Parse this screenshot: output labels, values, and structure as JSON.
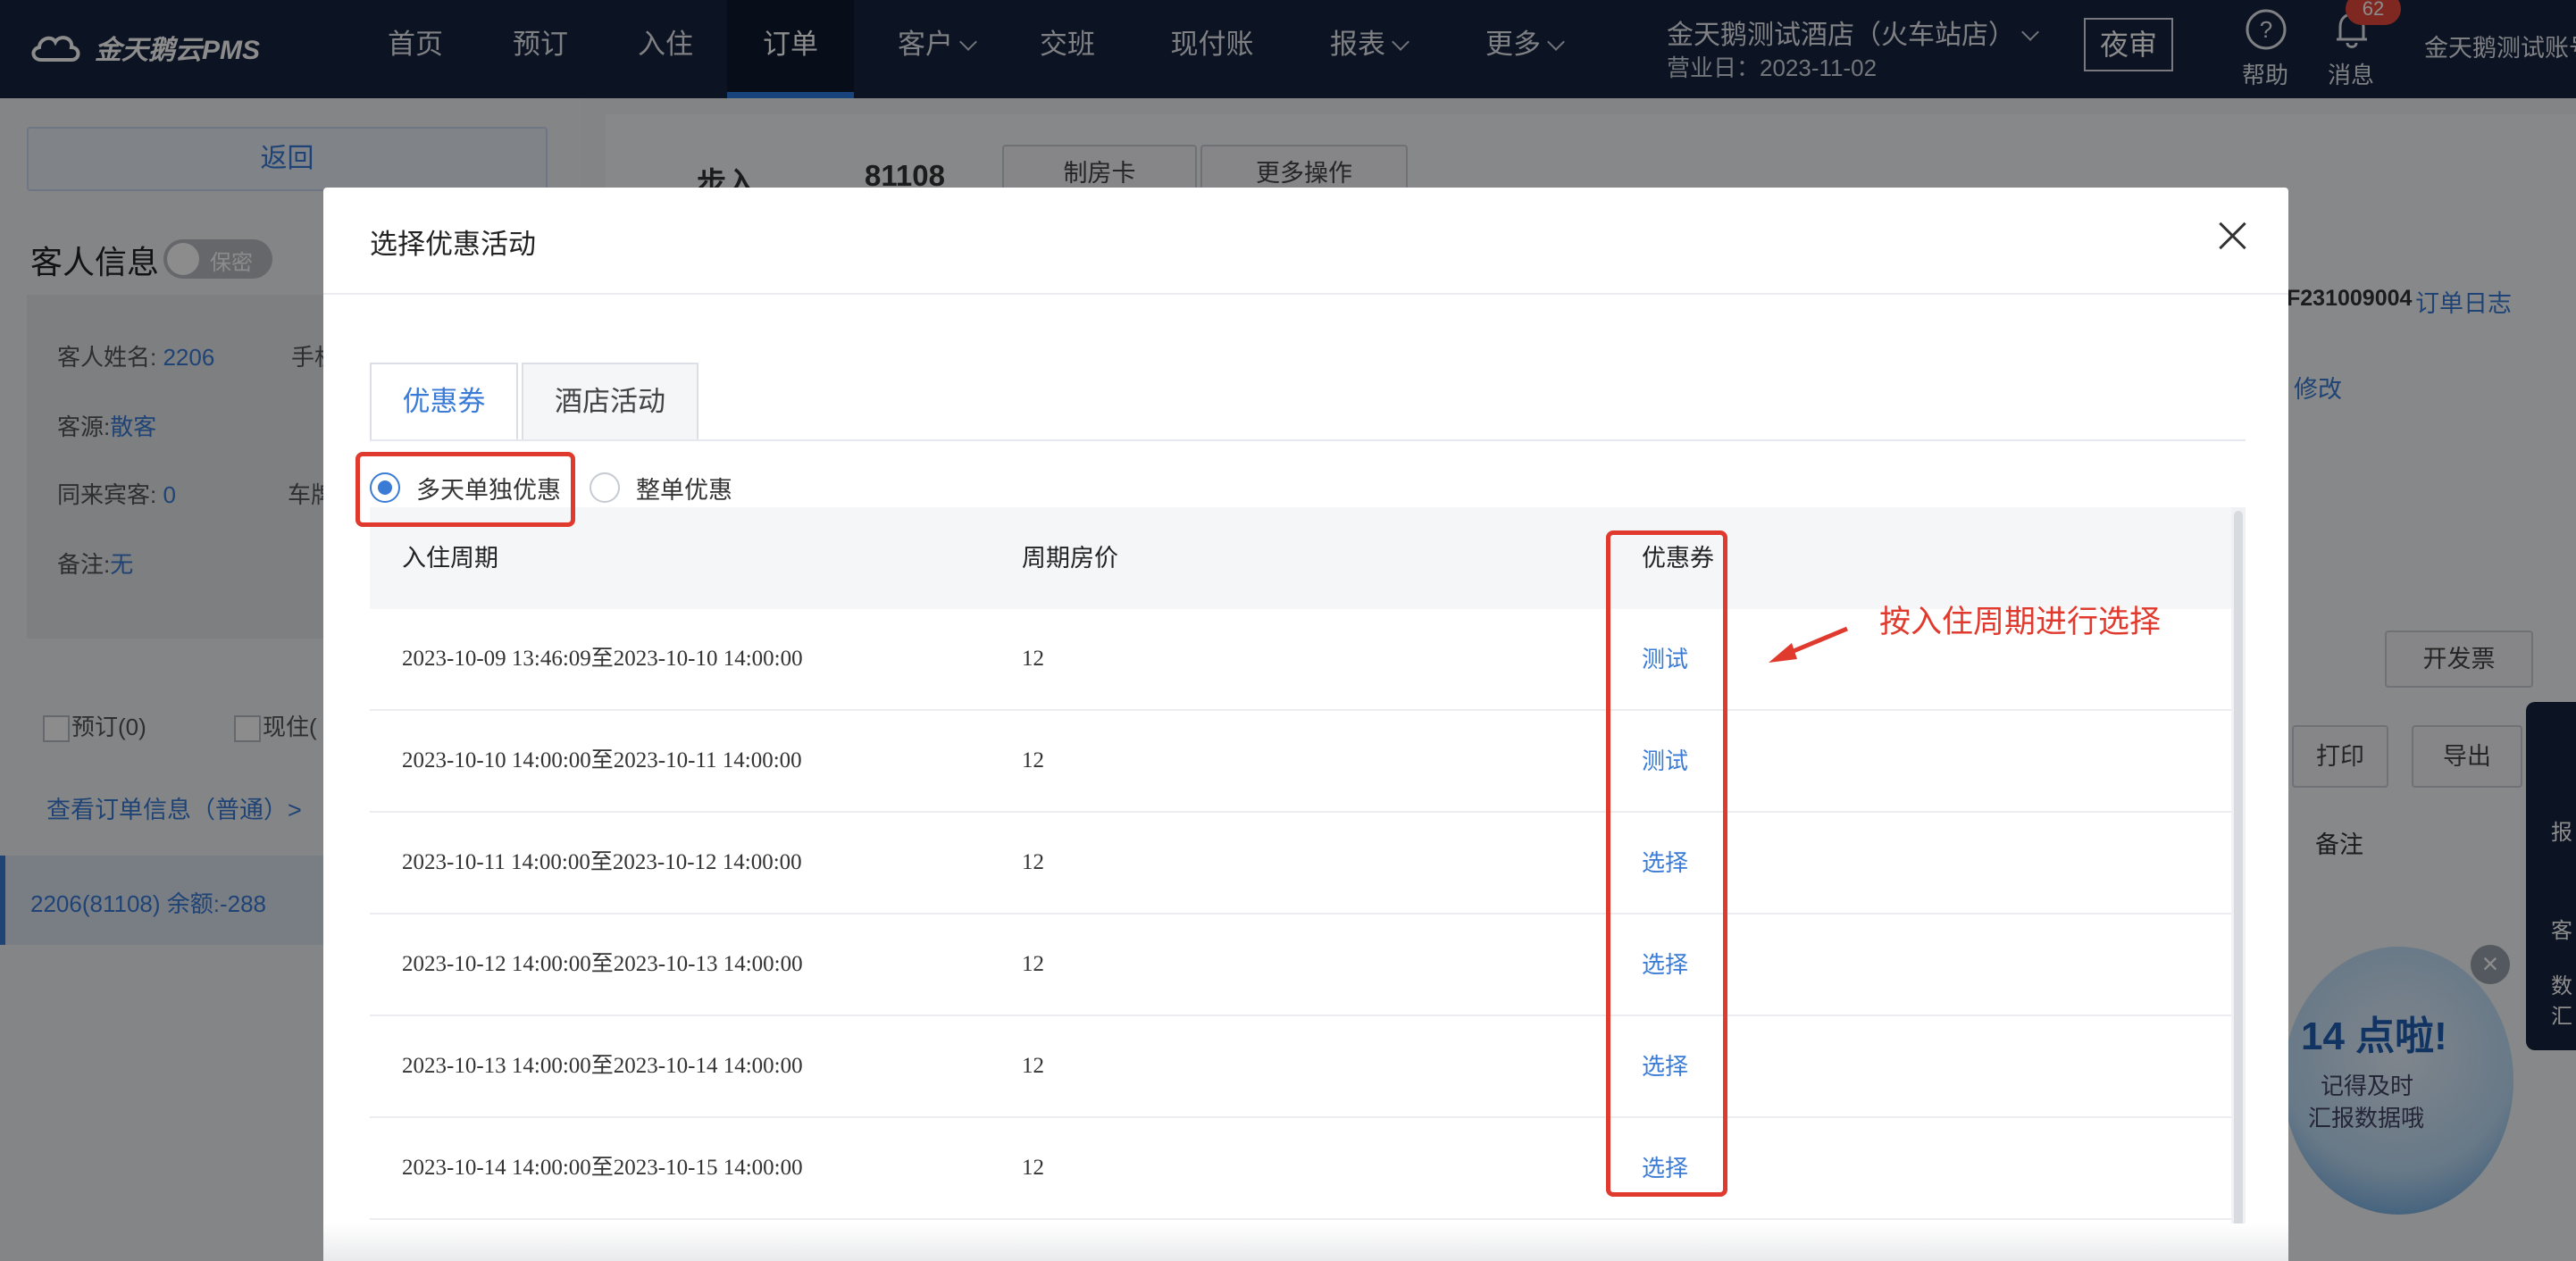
{
  "nav": {
    "logo": "金天鹅云PMS",
    "items": [
      "首页",
      "预订",
      "入住",
      "订单",
      "客户",
      "交班",
      "现付账",
      "报表",
      "更多"
    ],
    "hotel": "金天鹅测试酒店（火车站店）",
    "business_day": "营业日：2023-11-02",
    "night_audit": "夜审",
    "help": "帮助",
    "messages": "消息",
    "message_count": "62",
    "account": "金天鹅测试账号"
  },
  "background": {
    "back": "返回",
    "guest_info": "客人信息",
    "privacy": "保密",
    "guest_name_label": "客人姓名:",
    "guest_name": "2206",
    "phone_label": "手机",
    "source_label": "客源:",
    "source": "散客",
    "companions_label": "同来宾客:",
    "companions": "0",
    "car_label": "车牌",
    "remark_label": "备注:",
    "remark": "无",
    "reserved": "预订(0)",
    "checked_in": "现住(",
    "view_order": "查看订单信息（普通）>",
    "room_row": "2206(81108)   余额:-288",
    "walk_in": "步入",
    "order_no": "81108",
    "make_card": "制房卡",
    "more_ops": "更多操作",
    "order_code": "F231009004",
    "order_log": "订单日志",
    "modify": "修改",
    "invoice": "开发票",
    "print": "打印",
    "export": "导出",
    "remark_col": "备注",
    "reminder_title": "14 点啦!",
    "reminder_line1": "记得及时",
    "reminder_line2": "汇报数据哦",
    "side_report": "报",
    "side_customer": "客",
    "side_data1": "数",
    "side_data2": "汇"
  },
  "modal": {
    "title": "选择优惠活动",
    "tabs": [
      "优惠券",
      "酒店活动"
    ],
    "radios": [
      "多天单独优惠",
      "整单优惠"
    ],
    "columns": [
      "入住周期",
      "周期房价",
      "优惠券"
    ],
    "rows": [
      {
        "period": "2023-10-09 13:46:09至2023-10-10 14:00:00",
        "price": "12",
        "coupon": "测试"
      },
      {
        "period": "2023-10-10 14:00:00至2023-10-11 14:00:00",
        "price": "12",
        "coupon": "测试"
      },
      {
        "period": "2023-10-11 14:00:00至2023-10-12 14:00:00",
        "price": "12",
        "coupon": "选择"
      },
      {
        "period": "2023-10-12 14:00:00至2023-10-13 14:00:00",
        "price": "12",
        "coupon": "选择"
      },
      {
        "period": "2023-10-13 14:00:00至2023-10-14 14:00:00",
        "price": "12",
        "coupon": "选择"
      },
      {
        "period": "2023-10-14 14:00:00至2023-10-15 14:00:00",
        "price": "12",
        "coupon": "选择"
      }
    ],
    "annotation": "按入住周期进行选择"
  },
  "colors": {
    "accent": "#3a7bd5",
    "annotation": "#e0392d",
    "nav_bg": "#17243e"
  }
}
